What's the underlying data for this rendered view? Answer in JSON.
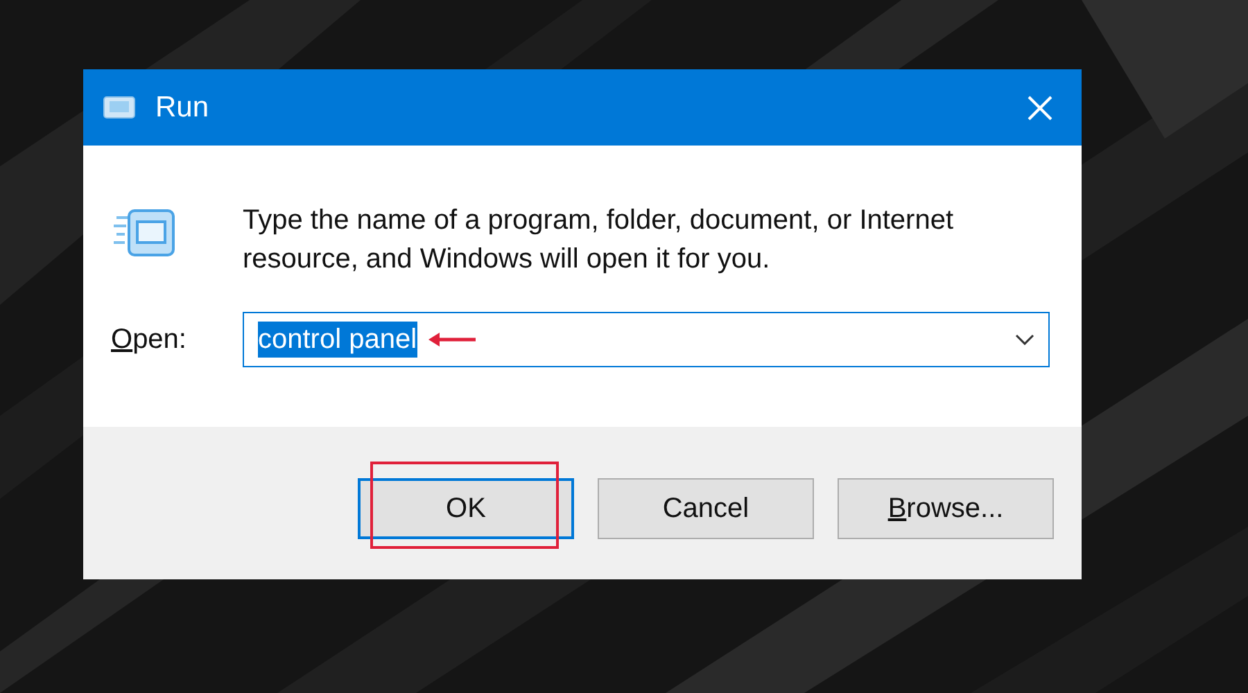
{
  "window": {
    "title": "Run"
  },
  "description": "Type the name of a program, folder, document, or Internet resource, and Windows will open it for you.",
  "open_field": {
    "label": "Open:",
    "label_underline_first": true,
    "value": "control panel",
    "text_selected": true,
    "arrow_annotation": true
  },
  "buttons": [
    {
      "label": "OK",
      "default": true,
      "underline_first": false,
      "highlighted": true
    },
    {
      "label": "Cancel",
      "default": false,
      "underline_first": false,
      "highlighted": false
    },
    {
      "label": "Browse...",
      "default": false,
      "underline_first": true,
      "highlighted": false
    }
  ]
}
